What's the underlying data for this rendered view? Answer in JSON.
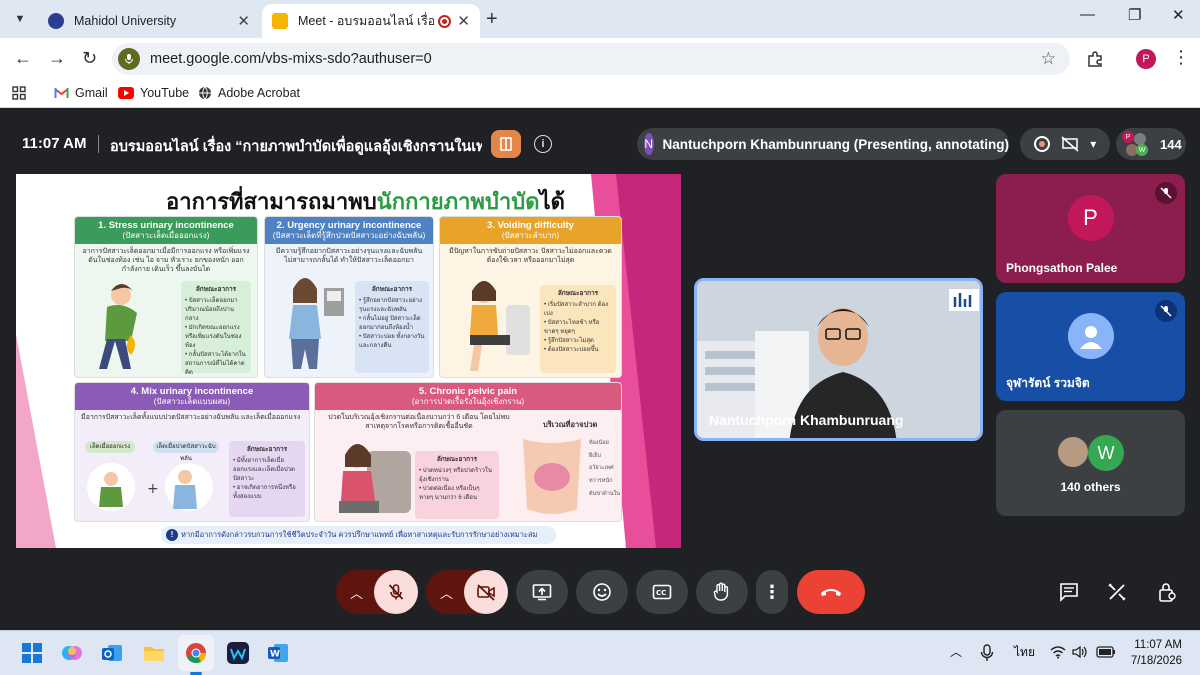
{
  "browser": {
    "tabs": [
      {
        "title": "Mahidol University",
        "active": false
      },
      {
        "title": "Meet - อบรมออนไลน์ เรื่อง “กา",
        "active": true
      }
    ],
    "url": "meet.google.com/vbs-mixs-sdo?authuser=0",
    "profile_initial": "P",
    "bookmarks": [
      "Gmail",
      "YouTube",
      "Adobe Acrobat"
    ]
  },
  "meet": {
    "time": "11:07 AM",
    "title": "อบรมออนไลน์ เรื่อง “กายภาพบำบัดเพื่อดูแลอุ้งเชิงกรานในเพ...",
    "presenter": {
      "initial": "N",
      "label": "Nantuchporn Khambunruang (Presenting, annotating)"
    },
    "participant_count": "144",
    "slide": {
      "title_prefix": "อาการที่สามารถมาพบ",
      "title_highlight": "นักกายภาพบำบัด",
      "title_suffix": "ได้",
      "cards": [
        {
          "heading": "1. Stress urinary incontinence",
          "sub": "(ปัสสาวะเล็ดเมื่อออกแรง)",
          "body": "อาการปัสสาวะเล็ดออกมาเมื่อมีการออกแรง หรือเพิ่มแรงดันในช่องท้อง เช่น ไอ จาม หัวเราะ ยกของหนัก ออกกำลังกาย เดินเร็ว ขึ้นลงบันได",
          "color": "#3a9b5c"
        },
        {
          "heading": "2. Urgency urinary incontinence",
          "sub": "(ปัสสาวะเล็ดที่รู้สึกปวดปัสสาวะอย่างฉับพลัน)",
          "body": "มีความรู้สึกอยากปัสสาวะอย่างรุนแรงและฉับพลัน ไม่สามารถกลั้นได้ ทำให้ปัสสาวะเล็ดออกมา",
          "color": "#4f82c3"
        },
        {
          "heading": "3. Voiding difficulty",
          "sub": "(ปัสสาวะลำบาก)",
          "body": "มีปัญหาในการขับถ่ายปัสสาวะ ปัสสาวะไม่ออกและตวด ต้องใช้เวลา หรือออกมาไม่สุด",
          "color": "#e8a32b"
        },
        {
          "heading": "4. Mix urinary incontinence",
          "sub": "(ปัสสาวะเล็ดแบบผสม)",
          "body": "มีอาการปัสสาวะเล็ดทั้งแบบปวดปัสสาวะอย่างฉับพลัน และเล็ดเมื่อออกแรง",
          "color": "#8a5cb8"
        },
        {
          "heading": "5. Chronic pelvic pain",
          "sub": "(อาการปวดเรื้อรังในอุ้งเชิงกราน)",
          "body": "ปวดในบริเวณอุ้งเชิงกรานต่อเนื่องนานกว่า 6 เดือน โดยไม่พบสาเหตุจากโรคหรือการติดเชื้ออื่นชัด",
          "color": "#d95a7f"
        }
      ],
      "symptom_title": "ลักษณะอาการ",
      "mix_labels": [
        "เล็ดเมื่อออกแรง",
        "เล็ดเมื่อปวดปัสสาวะฉับพลัน"
      ],
      "pain_area_label": "บริเวณที่อาจปวด",
      "footer": "หากมีอาการดังกล่าวรบกวนการใช้ชีวิตประจำวัน ควรปรึกษาแพทย์ เพื่อหาสาเหตุและรับการรักษาอย่างเหมาะสม"
    },
    "tiles": [
      {
        "name": "Phongsathon Palee",
        "initial": "P",
        "muted": true
      },
      {
        "name": "Nantuchporn Khambunruang",
        "muted": false
      },
      {
        "name": "จุฬารัตน์ รวมจิต",
        "muted": true
      },
      {
        "name": "140 others",
        "initial": "W"
      }
    ],
    "colors": {
      "end_call": "#ea4335",
      "muted_control": "#f9dedc",
      "muted_chevron": "#601410"
    }
  },
  "taskbar": {
    "lang": "ไทย",
    "time": "11:07 AM",
    "date": "7/18/2026"
  }
}
